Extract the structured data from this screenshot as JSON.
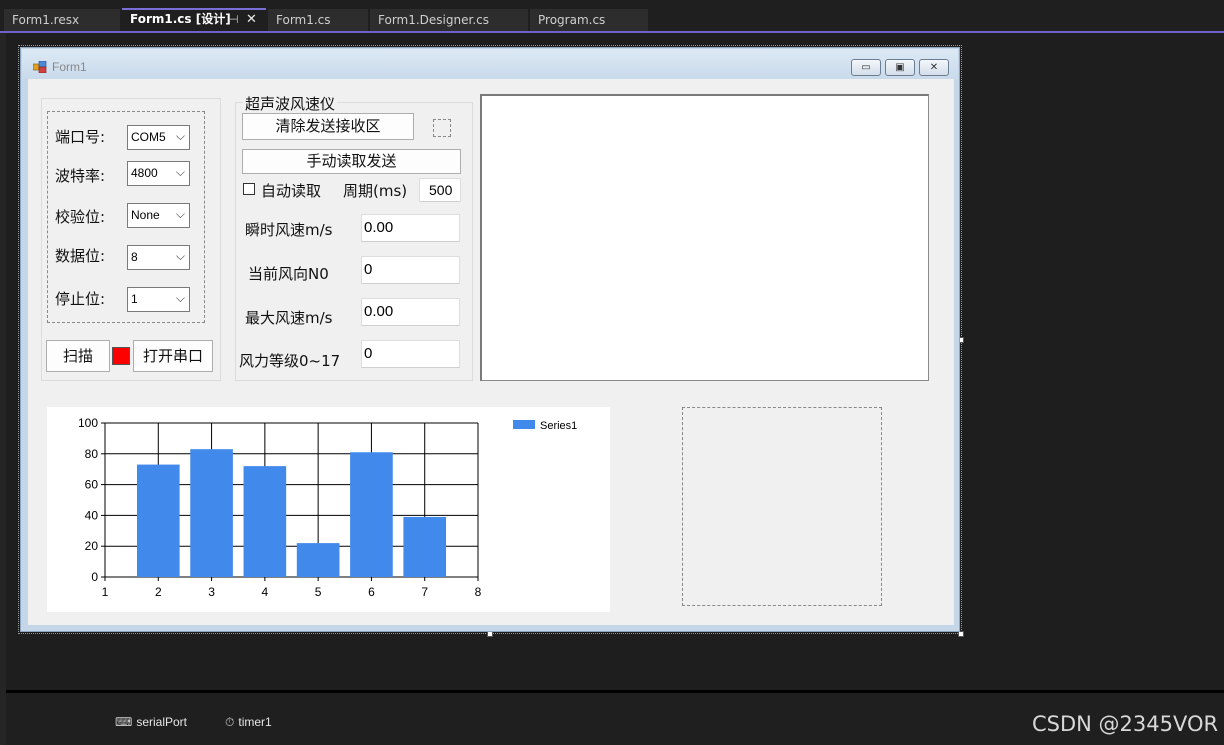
{
  "tabs": [
    {
      "label": "Form1.resx",
      "active": false
    },
    {
      "label": "Form1.cs [设计]",
      "active": true
    },
    {
      "label": "Form1.cs",
      "active": false
    },
    {
      "label": "Form1.Designer.cs",
      "active": false
    },
    {
      "label": "Program.cs",
      "active": false
    }
  ],
  "tab_icons": {
    "pin": "⊣",
    "close": "✕"
  },
  "form": {
    "title": "Form1",
    "caption_buttons": {
      "minimize": "▭",
      "maximize": "▣",
      "close": "✕"
    }
  },
  "serial": {
    "port_label": "端口号:",
    "port_value": "COM5",
    "baud_label": "波特率:",
    "baud_value": "4800",
    "parity_label": "校验位:",
    "parity_value": "None",
    "databits_label": "数据位:",
    "databits_value": "8",
    "stopbits_label": "停止位:",
    "stopbits_value": "1",
    "scan_button": "扫描",
    "open_button": "打开串口",
    "status_color": "#ff0000"
  },
  "meter": {
    "group_title": "超声波风速仪",
    "clear_button": "清除发送接收区",
    "manual_button": "手动读取发送",
    "auto_read_label": "自动读取",
    "auto_read_checked": false,
    "period_label": "周期(ms)",
    "period_value": "500",
    "speed_label": "瞬时风速m/s",
    "speed_value": "0.00",
    "direction_label": "当前风向N0",
    "direction_value": "0",
    "max_speed_label": "最大风速m/s",
    "max_speed_value": "0.00",
    "level_label": "风力等级0~17",
    "level_value": "0"
  },
  "chart_data": {
    "type": "bar",
    "x": [
      2,
      3,
      4,
      5,
      6,
      7
    ],
    "series": [
      {
        "name": "Series1",
        "values": [
          73,
          83,
          72,
          22,
          81,
          39
        ]
      }
    ],
    "xlim": [
      1,
      8
    ],
    "ylim": [
      0,
      100
    ],
    "x_ticks": [
      1,
      2,
      3,
      4,
      5,
      6,
      7,
      8
    ],
    "y_ticks": [
      0,
      20,
      40,
      60,
      80,
      100
    ],
    "grid": true,
    "legend": "top-right",
    "bar_color": "#4189ea"
  },
  "tray": {
    "items": [
      {
        "label": "serialPort",
        "icon": "serial-port-icon"
      },
      {
        "label": "timer1",
        "icon": "timer-icon"
      }
    ]
  },
  "watermark": "CSDN @2345VOR"
}
